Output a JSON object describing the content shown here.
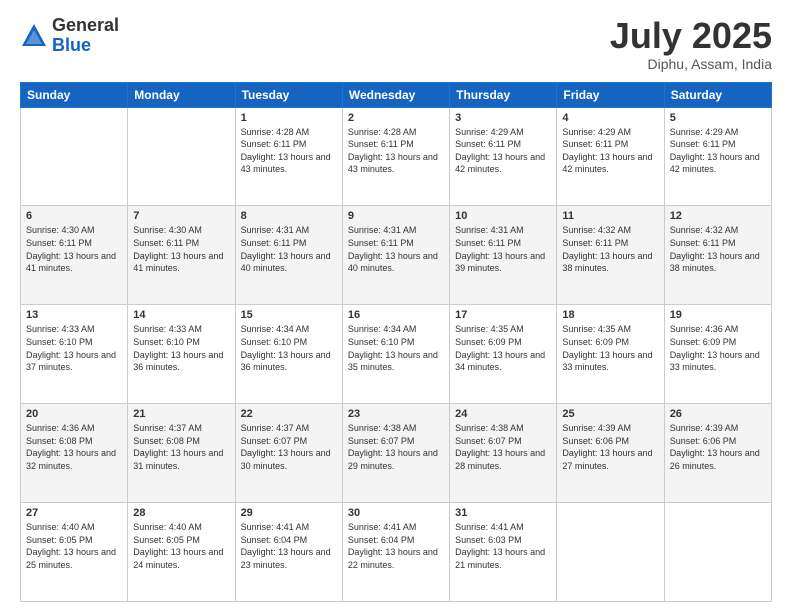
{
  "header": {
    "logo_general": "General",
    "logo_blue": "Blue",
    "month_title": "July 2025",
    "subtitle": "Diphu, Assam, India"
  },
  "days_of_week": [
    "Sunday",
    "Monday",
    "Tuesday",
    "Wednesday",
    "Thursday",
    "Friday",
    "Saturday"
  ],
  "weeks": [
    [
      {
        "day": "",
        "info": ""
      },
      {
        "day": "",
        "info": ""
      },
      {
        "day": "1",
        "info": "Sunrise: 4:28 AM\nSunset: 6:11 PM\nDaylight: 13 hours and 43 minutes."
      },
      {
        "day": "2",
        "info": "Sunrise: 4:28 AM\nSunset: 6:11 PM\nDaylight: 13 hours and 43 minutes."
      },
      {
        "day": "3",
        "info": "Sunrise: 4:29 AM\nSunset: 6:11 PM\nDaylight: 13 hours and 42 minutes."
      },
      {
        "day": "4",
        "info": "Sunrise: 4:29 AM\nSunset: 6:11 PM\nDaylight: 13 hours and 42 minutes."
      },
      {
        "day": "5",
        "info": "Sunrise: 4:29 AM\nSunset: 6:11 PM\nDaylight: 13 hours and 42 minutes."
      }
    ],
    [
      {
        "day": "6",
        "info": "Sunrise: 4:30 AM\nSunset: 6:11 PM\nDaylight: 13 hours and 41 minutes."
      },
      {
        "day": "7",
        "info": "Sunrise: 4:30 AM\nSunset: 6:11 PM\nDaylight: 13 hours and 41 minutes."
      },
      {
        "day": "8",
        "info": "Sunrise: 4:31 AM\nSunset: 6:11 PM\nDaylight: 13 hours and 40 minutes."
      },
      {
        "day": "9",
        "info": "Sunrise: 4:31 AM\nSunset: 6:11 PM\nDaylight: 13 hours and 40 minutes."
      },
      {
        "day": "10",
        "info": "Sunrise: 4:31 AM\nSunset: 6:11 PM\nDaylight: 13 hours and 39 minutes."
      },
      {
        "day": "11",
        "info": "Sunrise: 4:32 AM\nSunset: 6:11 PM\nDaylight: 13 hours and 38 minutes."
      },
      {
        "day": "12",
        "info": "Sunrise: 4:32 AM\nSunset: 6:11 PM\nDaylight: 13 hours and 38 minutes."
      }
    ],
    [
      {
        "day": "13",
        "info": "Sunrise: 4:33 AM\nSunset: 6:10 PM\nDaylight: 13 hours and 37 minutes."
      },
      {
        "day": "14",
        "info": "Sunrise: 4:33 AM\nSunset: 6:10 PM\nDaylight: 13 hours and 36 minutes."
      },
      {
        "day": "15",
        "info": "Sunrise: 4:34 AM\nSunset: 6:10 PM\nDaylight: 13 hours and 36 minutes."
      },
      {
        "day": "16",
        "info": "Sunrise: 4:34 AM\nSunset: 6:10 PM\nDaylight: 13 hours and 35 minutes."
      },
      {
        "day": "17",
        "info": "Sunrise: 4:35 AM\nSunset: 6:09 PM\nDaylight: 13 hours and 34 minutes."
      },
      {
        "day": "18",
        "info": "Sunrise: 4:35 AM\nSunset: 6:09 PM\nDaylight: 13 hours and 33 minutes."
      },
      {
        "day": "19",
        "info": "Sunrise: 4:36 AM\nSunset: 6:09 PM\nDaylight: 13 hours and 33 minutes."
      }
    ],
    [
      {
        "day": "20",
        "info": "Sunrise: 4:36 AM\nSunset: 6:08 PM\nDaylight: 13 hours and 32 minutes."
      },
      {
        "day": "21",
        "info": "Sunrise: 4:37 AM\nSunset: 6:08 PM\nDaylight: 13 hours and 31 minutes."
      },
      {
        "day": "22",
        "info": "Sunrise: 4:37 AM\nSunset: 6:07 PM\nDaylight: 13 hours and 30 minutes."
      },
      {
        "day": "23",
        "info": "Sunrise: 4:38 AM\nSunset: 6:07 PM\nDaylight: 13 hours and 29 minutes."
      },
      {
        "day": "24",
        "info": "Sunrise: 4:38 AM\nSunset: 6:07 PM\nDaylight: 13 hours and 28 minutes."
      },
      {
        "day": "25",
        "info": "Sunrise: 4:39 AM\nSunset: 6:06 PM\nDaylight: 13 hours and 27 minutes."
      },
      {
        "day": "26",
        "info": "Sunrise: 4:39 AM\nSunset: 6:06 PM\nDaylight: 13 hours and 26 minutes."
      }
    ],
    [
      {
        "day": "27",
        "info": "Sunrise: 4:40 AM\nSunset: 6:05 PM\nDaylight: 13 hours and 25 minutes."
      },
      {
        "day": "28",
        "info": "Sunrise: 4:40 AM\nSunset: 6:05 PM\nDaylight: 13 hours and 24 minutes."
      },
      {
        "day": "29",
        "info": "Sunrise: 4:41 AM\nSunset: 6:04 PM\nDaylight: 13 hours and 23 minutes."
      },
      {
        "day": "30",
        "info": "Sunrise: 4:41 AM\nSunset: 6:04 PM\nDaylight: 13 hours and 22 minutes."
      },
      {
        "day": "31",
        "info": "Sunrise: 4:41 AM\nSunset: 6:03 PM\nDaylight: 13 hours and 21 minutes."
      },
      {
        "day": "",
        "info": ""
      },
      {
        "day": "",
        "info": ""
      }
    ]
  ]
}
